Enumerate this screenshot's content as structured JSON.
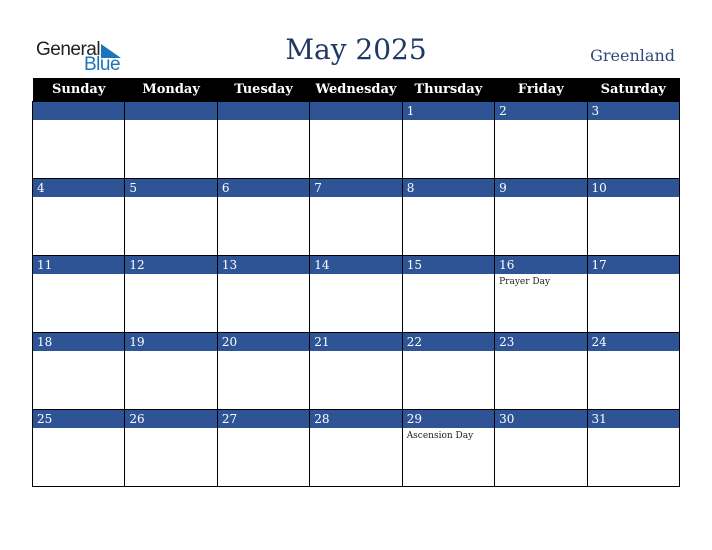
{
  "logo": {
    "general": "General",
    "blue": "Blue"
  },
  "title": "May 2025",
  "country": "Greenland",
  "weekdays": [
    "Sunday",
    "Monday",
    "Tuesday",
    "Wednesday",
    "Thursday",
    "Friday",
    "Saturday"
  ],
  "weeks": [
    [
      {
        "d": ""
      },
      {
        "d": ""
      },
      {
        "d": ""
      },
      {
        "d": ""
      },
      {
        "d": "1"
      },
      {
        "d": "2"
      },
      {
        "d": "3"
      }
    ],
    [
      {
        "d": "4"
      },
      {
        "d": "5"
      },
      {
        "d": "6"
      },
      {
        "d": "7"
      },
      {
        "d": "8"
      },
      {
        "d": "9"
      },
      {
        "d": "10"
      }
    ],
    [
      {
        "d": "11"
      },
      {
        "d": "12"
      },
      {
        "d": "13"
      },
      {
        "d": "14"
      },
      {
        "d": "15"
      },
      {
        "d": "16",
        "h": "Prayer Day"
      },
      {
        "d": "17"
      }
    ],
    [
      {
        "d": "18"
      },
      {
        "d": "19"
      },
      {
        "d": "20"
      },
      {
        "d": "21"
      },
      {
        "d": "22"
      },
      {
        "d": "23"
      },
      {
        "d": "24"
      }
    ],
    [
      {
        "d": "25"
      },
      {
        "d": "26"
      },
      {
        "d": "27"
      },
      {
        "d": "28"
      },
      {
        "d": "29",
        "h": "Ascension Day"
      },
      {
        "d": "30"
      },
      {
        "d": "31"
      }
    ]
  ]
}
